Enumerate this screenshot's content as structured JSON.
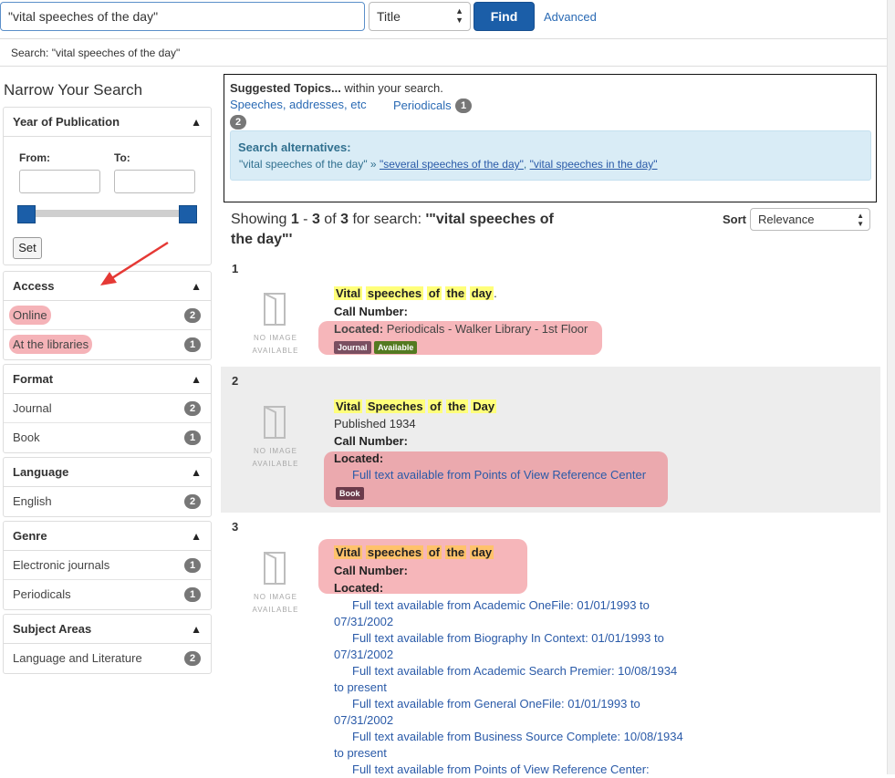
{
  "search": {
    "query": "\"vital speeches of the day\"",
    "field": "Title",
    "find_label": "Find",
    "advanced_label": "Advanced",
    "echo": "Search: \"vital speeches of the day\""
  },
  "sidebar": {
    "title": "Narrow Your Search",
    "year": {
      "heading": "Year of Publication",
      "from_label": "From:",
      "to_label": "To:",
      "set_label": "Set"
    },
    "facets": [
      {
        "heading": "Access",
        "items": [
          {
            "label": "Online",
            "count": "2"
          },
          {
            "label": "At the libraries",
            "count": "1"
          }
        ]
      },
      {
        "heading": "Format",
        "items": [
          {
            "label": "Journal",
            "count": "2"
          },
          {
            "label": "Book",
            "count": "1"
          }
        ]
      },
      {
        "heading": "Language",
        "items": [
          {
            "label": "English",
            "count": "2"
          }
        ]
      },
      {
        "heading": "Genre",
        "items": [
          {
            "label": "Electronic journals",
            "count": "1"
          },
          {
            "label": "Periodicals",
            "count": "1"
          }
        ]
      },
      {
        "heading": "Subject Areas",
        "items": [
          {
            "label": "Language and Literature",
            "count": "2"
          }
        ]
      }
    ],
    "collapse_glyph": "▲"
  },
  "suggested": {
    "heading_bold": "Suggested Topics...",
    "heading_rest": " within your search.",
    "topics": [
      {
        "label": "Speeches, addresses, etc",
        "count": "2"
      },
      {
        "label": "Periodicals",
        "count": "1"
      }
    ],
    "alt_heading": "Search alternatives:",
    "alt_original": "\"vital speeches of the day\" »",
    "alt_options": [
      "\"several speeches of the day\"",
      "\"vital speeches in the day\""
    ],
    "alt_separator": ","
  },
  "results_header": {
    "showing_prefix": "Showing ",
    "range_start": "1",
    "range_sep": " - ",
    "range_end": "3",
    "of_text": " of ",
    "total": "3",
    "for_text": " for search: ",
    "query_display": "'\"vital speeches of the day\"'",
    "sort_label": "Sort",
    "sort_value": "Relevance"
  },
  "no_image": {
    "line1": "NO IMAGE",
    "line2": "AVAILABLE"
  },
  "results": [
    {
      "num": "1",
      "title_words": [
        "Vital",
        "speeches",
        "of",
        "the",
        "day"
      ],
      "title_suffix": ".",
      "call_number_label": "Call Number:",
      "located_label": "Located:",
      "located_value": " Periodicals - Walker Library - 1st Floor",
      "tags": [
        "Journal",
        "Available"
      ]
    },
    {
      "num": "2",
      "title_words": [
        "Vital",
        "Speeches",
        "of",
        "the",
        "Day"
      ],
      "published": "Published 1934",
      "call_number_label": "Call Number:",
      "located_label": "Located:",
      "links": [
        "Full text available from Points of View Reference Center"
      ],
      "tags": [
        "Book"
      ]
    },
    {
      "num": "3",
      "title_words": [
        "Vital",
        "speeches",
        "of",
        "the",
        "day"
      ],
      "call_number_label": "Call Number:",
      "located_label": "Located:",
      "links": [
        "Full text available from Academic OneFile: 01/01/1993 to 07/31/2002",
        "Full text available from Biography In Context: 01/01/1993 to 07/31/2002",
        "Full text available from Academic Search Premier: 10/08/1934 to present",
        "Full text available from General OneFile: 01/01/1993 to 07/31/2002",
        "Full text available from Business Source Complete: 10/08/1934 to present",
        "Full text available from Points of View Reference Center:"
      ]
    }
  ],
  "colors": {
    "primary": "#1b5ea8",
    "link": "#2a6ab4",
    "highlight_yellow": "#ffff7a",
    "highlight_orange": "#ffc26b",
    "annotation_pink": "#f6b6ba",
    "annotation_arrow": "#e53935",
    "alt_box": "#d9ecf6",
    "badge": "#777777"
  }
}
